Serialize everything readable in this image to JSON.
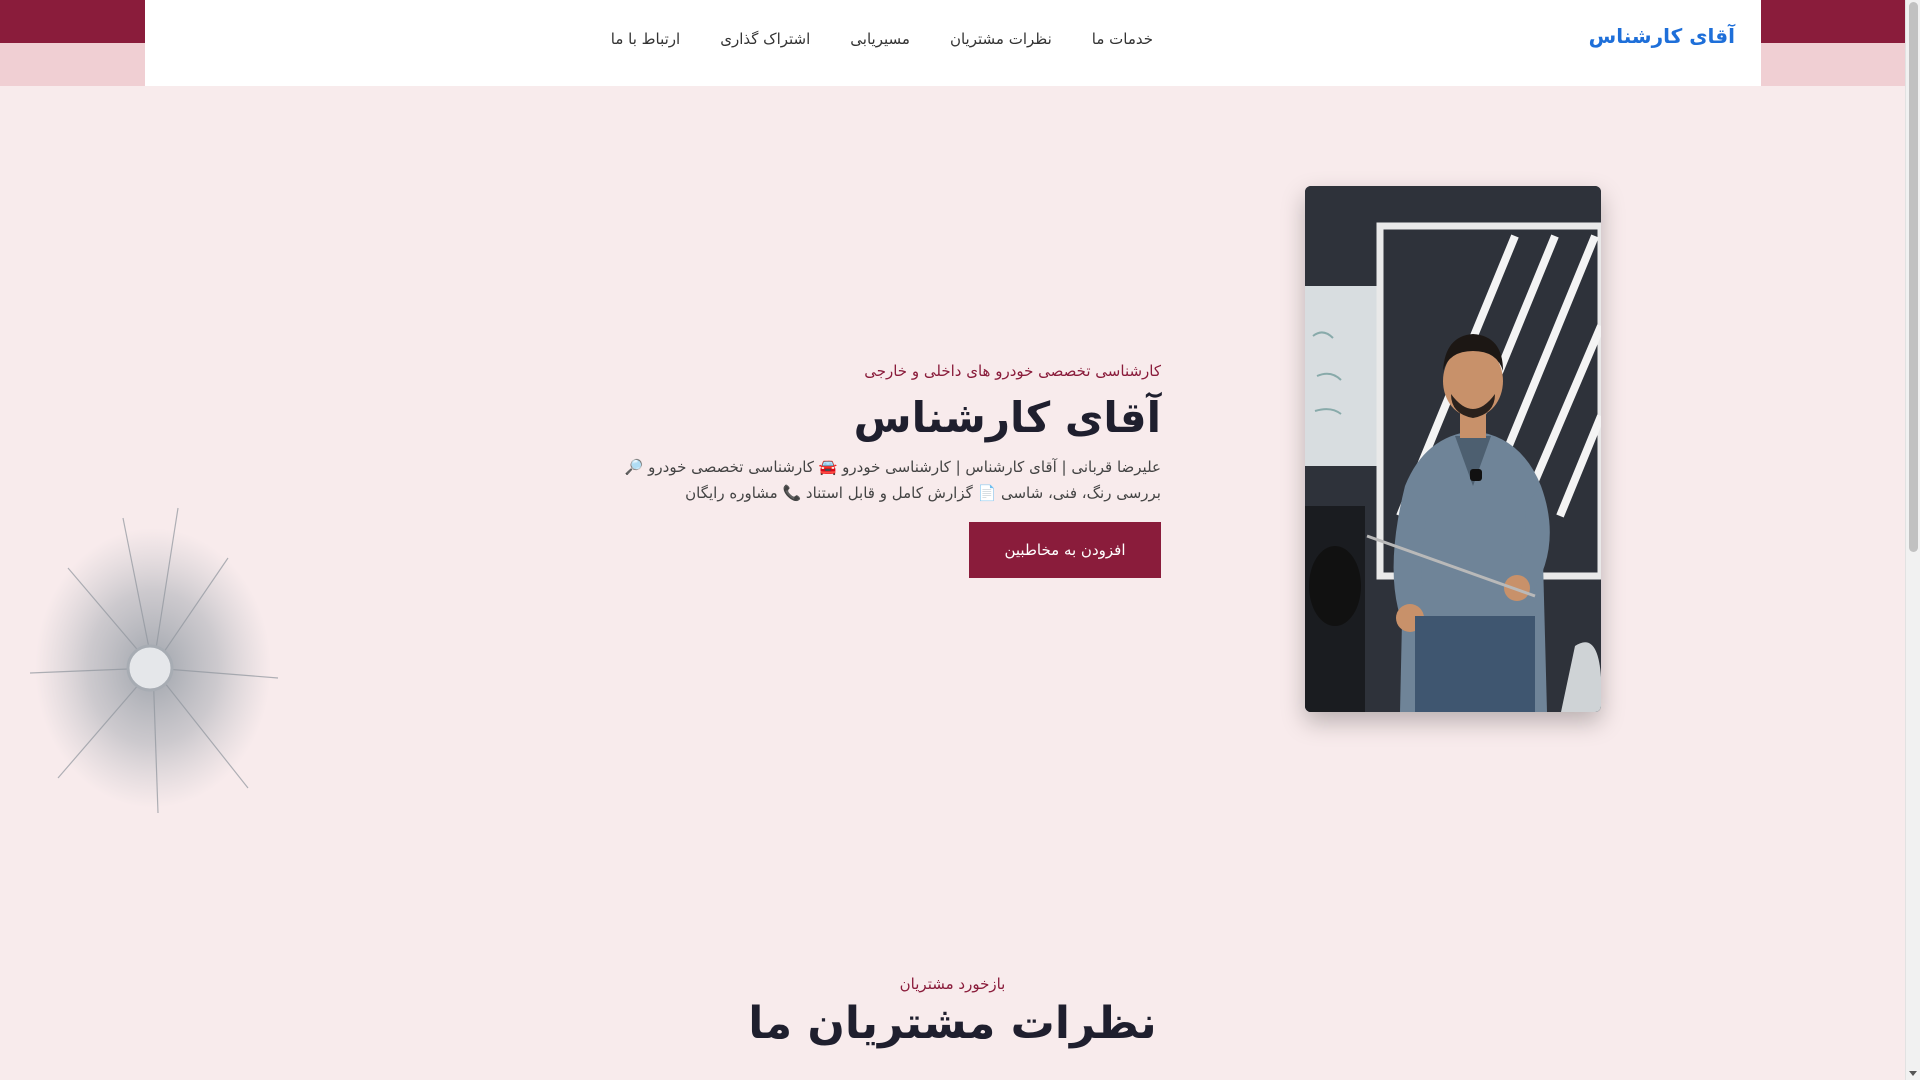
{
  "header": {
    "brand": "آقای کارشناس",
    "nav": [
      "خدمات ما",
      "نظرات مشتریان",
      "مسیریابی",
      "اشتراک گذاری",
      "ارتباط با ما"
    ]
  },
  "hero": {
    "subtitle": "کارشناسی تخصصی خودرو های داخلی و خارجی",
    "title": "آقای کارشناس",
    "description_line1": "علیرضا قربانی | آقای کارشناس | کارشناسی خودرو 🚘 کارشناسی تخصصی خودرو 🔎",
    "description_line2": "بررسی رنگ، فنی، شاسی 📄 گزارش کامل و قابل استناد 📞 مشاوره رایگان",
    "cta_label": "افزودن به مخاطبین"
  },
  "testimonials": {
    "kicker": "بازخورد مشتریان",
    "title": "نظرات مشتریان ما"
  },
  "colors": {
    "primary": "#8a1c3b",
    "background": "#f8ebec",
    "brand": "#1e6fd9"
  }
}
